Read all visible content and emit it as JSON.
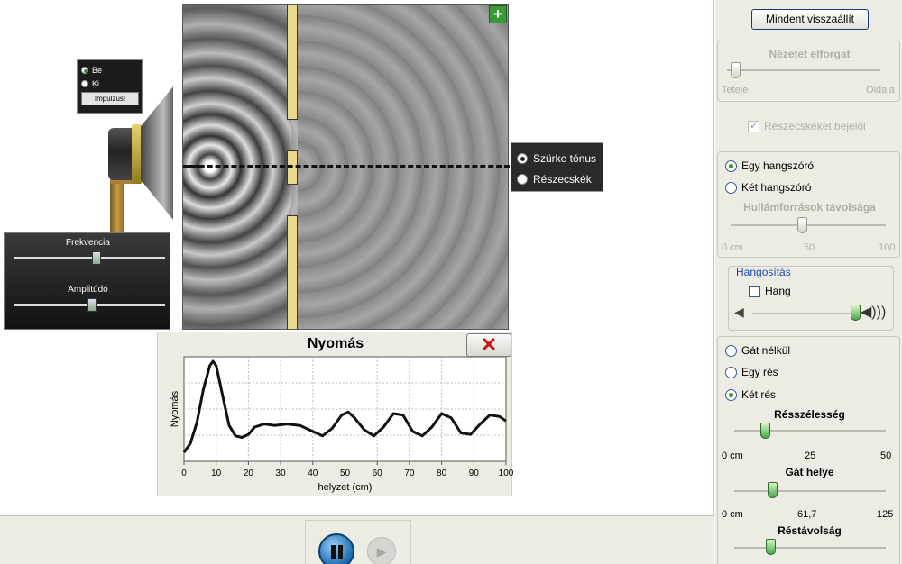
{
  "wave_view": {
    "view_options": [
      {
        "label": "Szürke tónus",
        "selected": true
      },
      {
        "label": "Részecskék",
        "selected": false
      }
    ],
    "zoom_button": "+"
  },
  "source_panel": {
    "on_label": "Be",
    "off_label": "Ki",
    "on_selected": true,
    "impulse_label": "Impulzus!",
    "frequency_label": "Frekvencia",
    "frequency_level": 0.55,
    "amplitude_label": "Amplitúdó",
    "amplitude_level": 0.52
  },
  "pressure_chart": {
    "close_label": "✕",
    "chart_data": {
      "type": "line",
      "title": "Nyomás",
      "xlabel": "helyzet (cm)",
      "ylabel": "Nyomás",
      "xlim": [
        0,
        100
      ],
      "xticks": [
        "0",
        "10",
        "20",
        "30",
        "40",
        "50",
        "60",
        "70",
        "80",
        "90",
        "100"
      ],
      "grid": true,
      "series": [
        {
          "x": [
            0,
            2,
            4,
            6,
            8,
            9,
            10,
            12,
            14,
            16,
            18,
            20,
            22,
            25,
            28,
            32,
            36,
            40,
            43,
            46,
            49,
            51,
            53,
            56,
            59,
            62,
            65,
            68,
            71,
            74,
            77,
            80,
            83,
            86,
            89,
            92,
            95,
            98,
            100
          ],
          "y": [
            -0.9,
            -0.6,
            0.1,
            1.2,
            2.0,
            2.15,
            2.0,
            1.0,
            0.0,
            -0.35,
            -0.4,
            -0.3,
            -0.05,
            0.05,
            0.0,
            0.05,
            0.0,
            -0.2,
            -0.35,
            -0.1,
            0.35,
            0.45,
            0.25,
            -0.15,
            -0.35,
            -0.05,
            0.4,
            0.35,
            -0.2,
            -0.35,
            -0.05,
            0.4,
            0.25,
            -0.25,
            -0.3,
            0.05,
            0.35,
            0.3,
            0.15
          ]
        }
      ],
      "ylim": [
        -1.2,
        2.3
      ]
    }
  },
  "right_panel": {
    "reset_label": "Mindent visszaállít",
    "rotate": {
      "title": "Nézetet elforgat",
      "left_label": "Teteje",
      "right_label": "Oldala",
      "level": 0.05,
      "enabled": false
    },
    "mark_particles": {
      "label": "Részecskéket bejelöl",
      "checked": true,
      "enabled": false
    },
    "sources": {
      "options": [
        {
          "label": "Egy hangszóró",
          "selected": true
        },
        {
          "label": "Két hangszóró",
          "selected": false
        }
      ],
      "distance_title": "Hullámforrások távolsága",
      "distance_ticks": [
        "0 cm",
        "50",
        "100"
      ],
      "distance_level": 0.46,
      "enabled": false
    },
    "audio": {
      "title": "Hangosítás",
      "sound_label": "Hang",
      "sound_checked": false,
      "volume_level": 0.98
    },
    "barrier": {
      "options": [
        {
          "label": "Gát nélkül",
          "selected": false
        },
        {
          "label": "Egy rés",
          "selected": false
        },
        {
          "label": "Két rés",
          "selected": true
        }
      ],
      "slit_width_title": "Résszélesség",
      "slit_width_ticks": [
        "0 cm",
        "25",
        "50"
      ],
      "slit_width_level": 0.2,
      "position_title": "Gát helye",
      "position_ticks": [
        "0 cm",
        "61,7",
        "125"
      ],
      "position_level": 0.25,
      "separation_title": "Réstávolság",
      "separation_level": 0.24
    }
  },
  "playback": {
    "pause_label": "pause",
    "step_label": "step"
  },
  "colors": {
    "barrier": "#e9d98c",
    "panel_bg": "#ecebe4",
    "accent_green": "#2a9a2a",
    "close_red": "#cc1010"
  }
}
